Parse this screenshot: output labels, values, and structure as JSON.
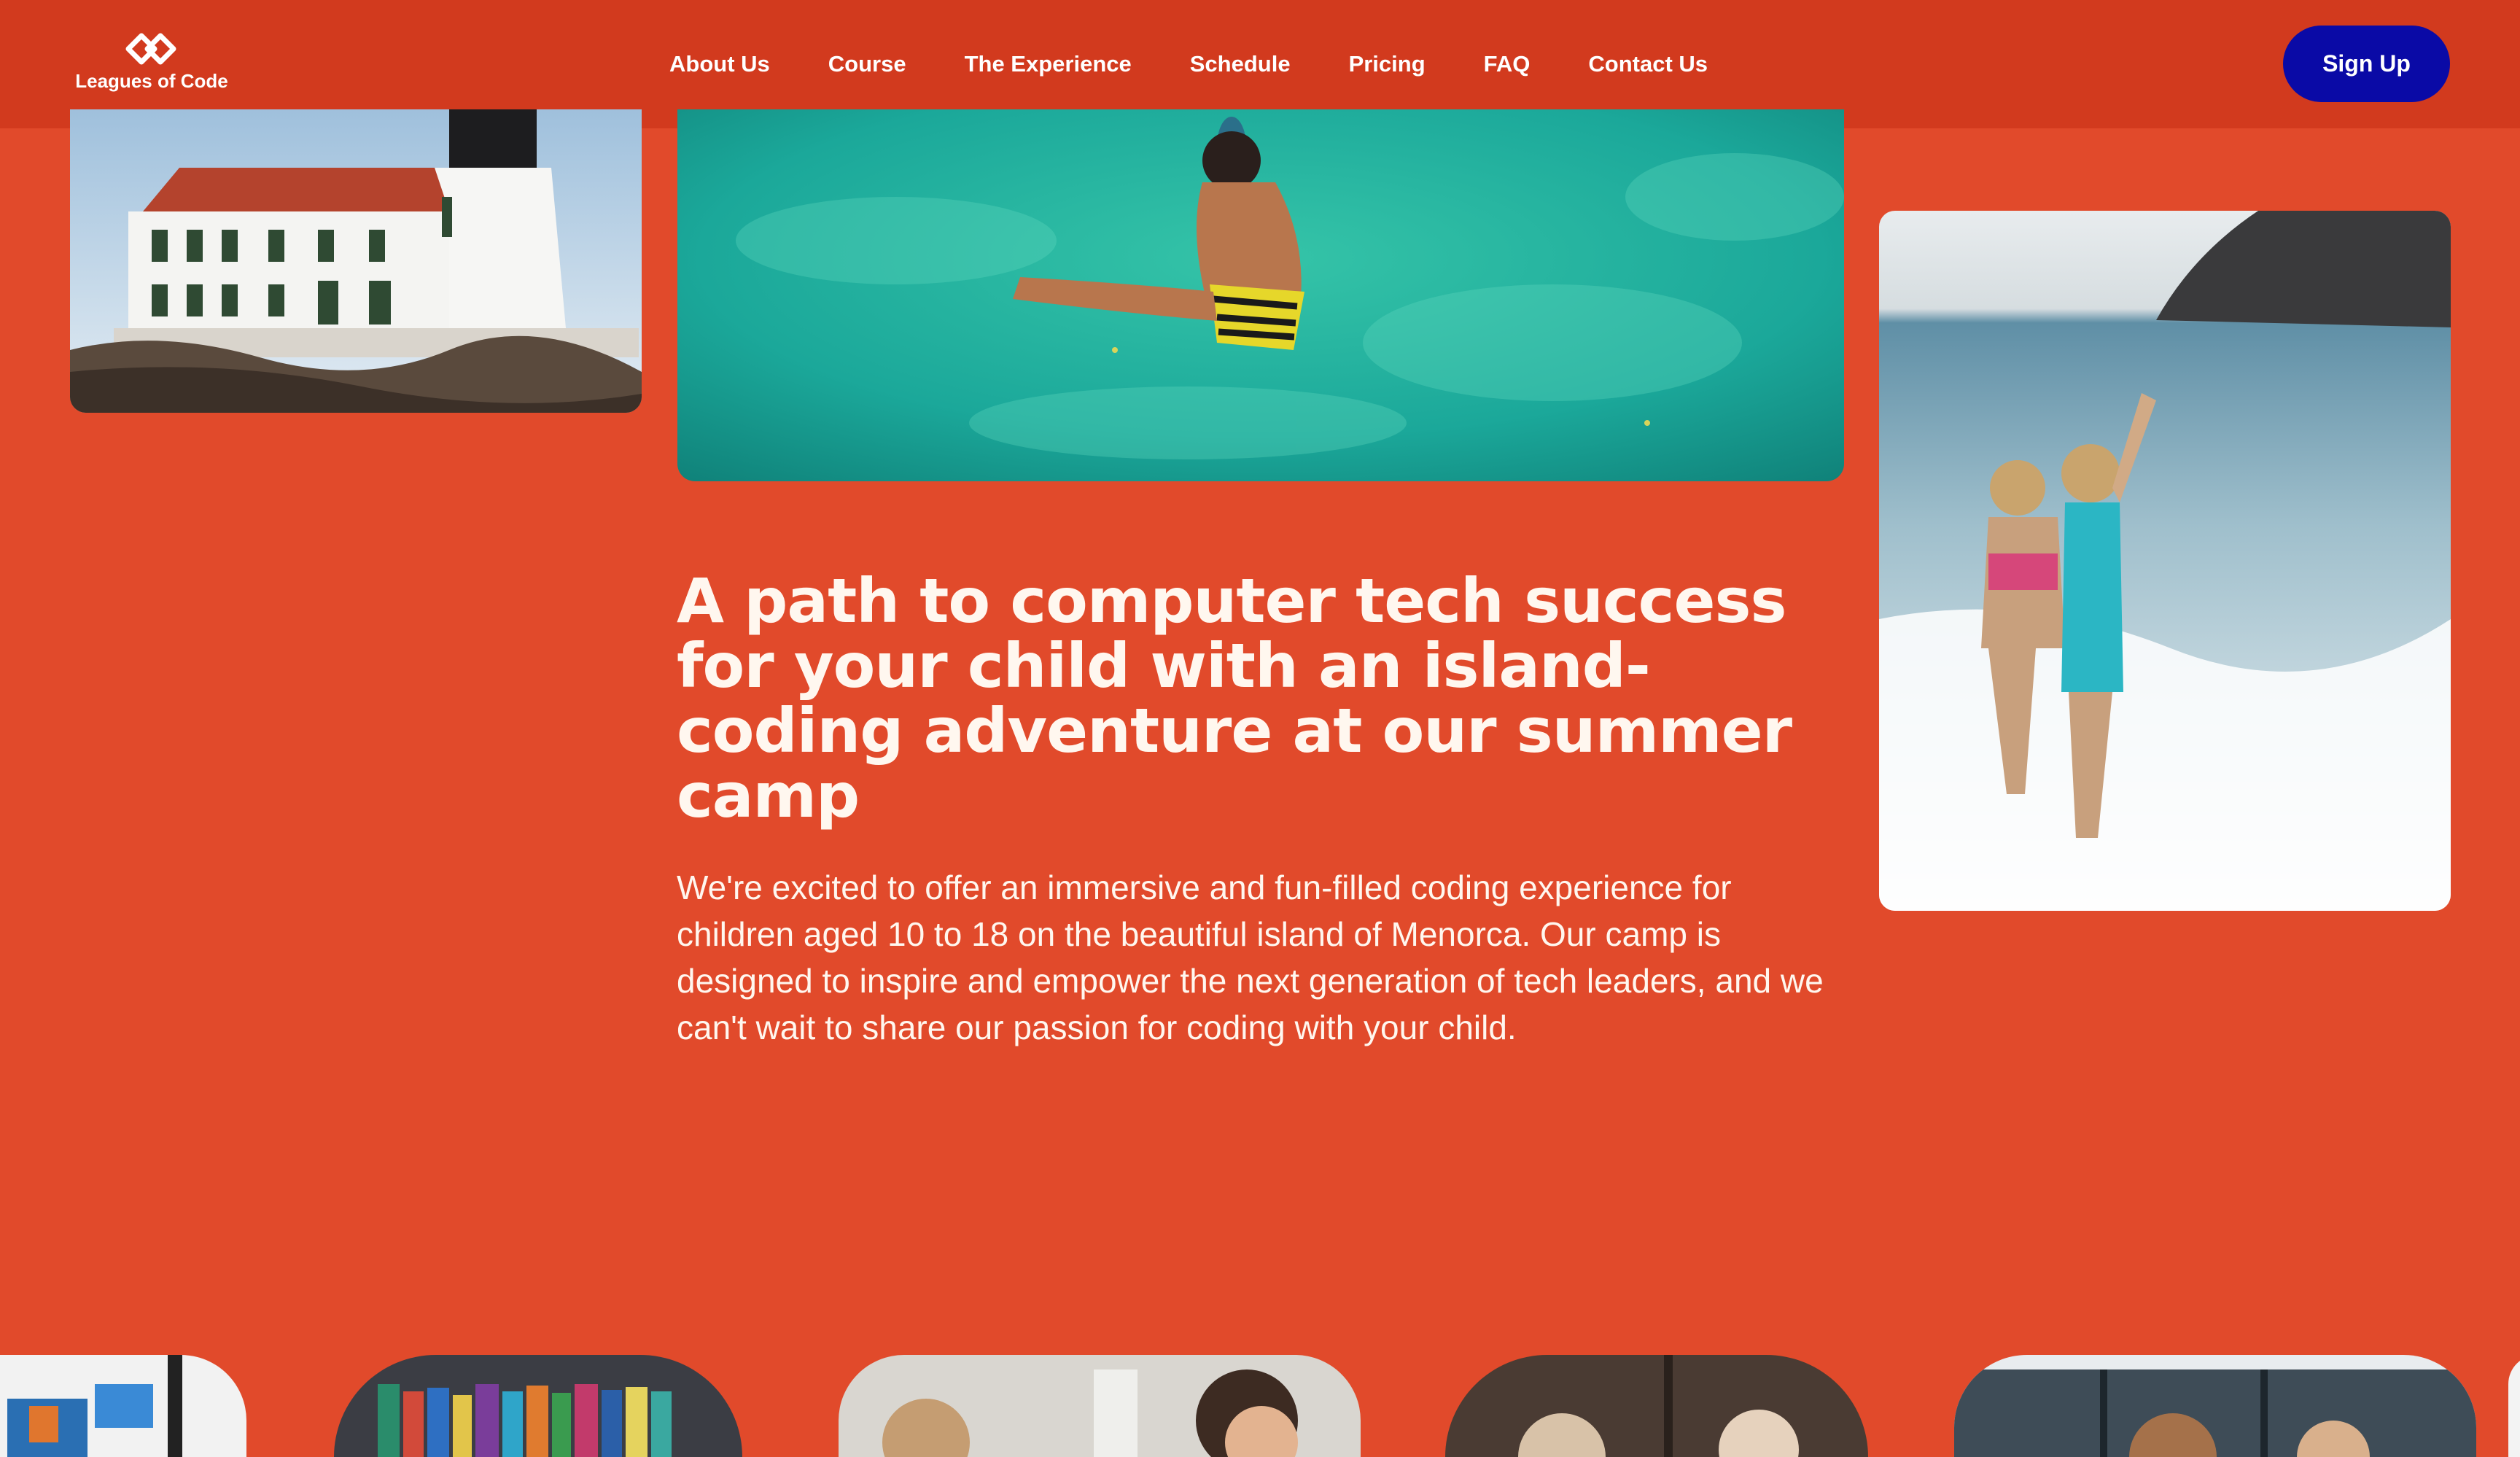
{
  "header": {
    "brand": "Leagues of Code",
    "nav": [
      "About Us",
      "Course",
      "The Experience",
      "Schedule",
      "Pricing",
      "FAQ",
      "Contact Us"
    ],
    "signup_label": "Sign Up"
  },
  "hero": {
    "headline": "A path to computer tech success for your child with an island-coding adventure at our summer camp",
    "intro": "We're excited to offer an immersive and fun-filled coding experience for children aged 10 to 18 on the beautiful island of Menorca. Our camp is designed to inspire and empower the next generation of tech leaders, and we can't wait to share our passion for coding with your child."
  },
  "colors": {
    "background": "#e14a2b",
    "header": "#d23a1e",
    "signup_button": "#0a0aa6",
    "text": "#fff7ef"
  }
}
